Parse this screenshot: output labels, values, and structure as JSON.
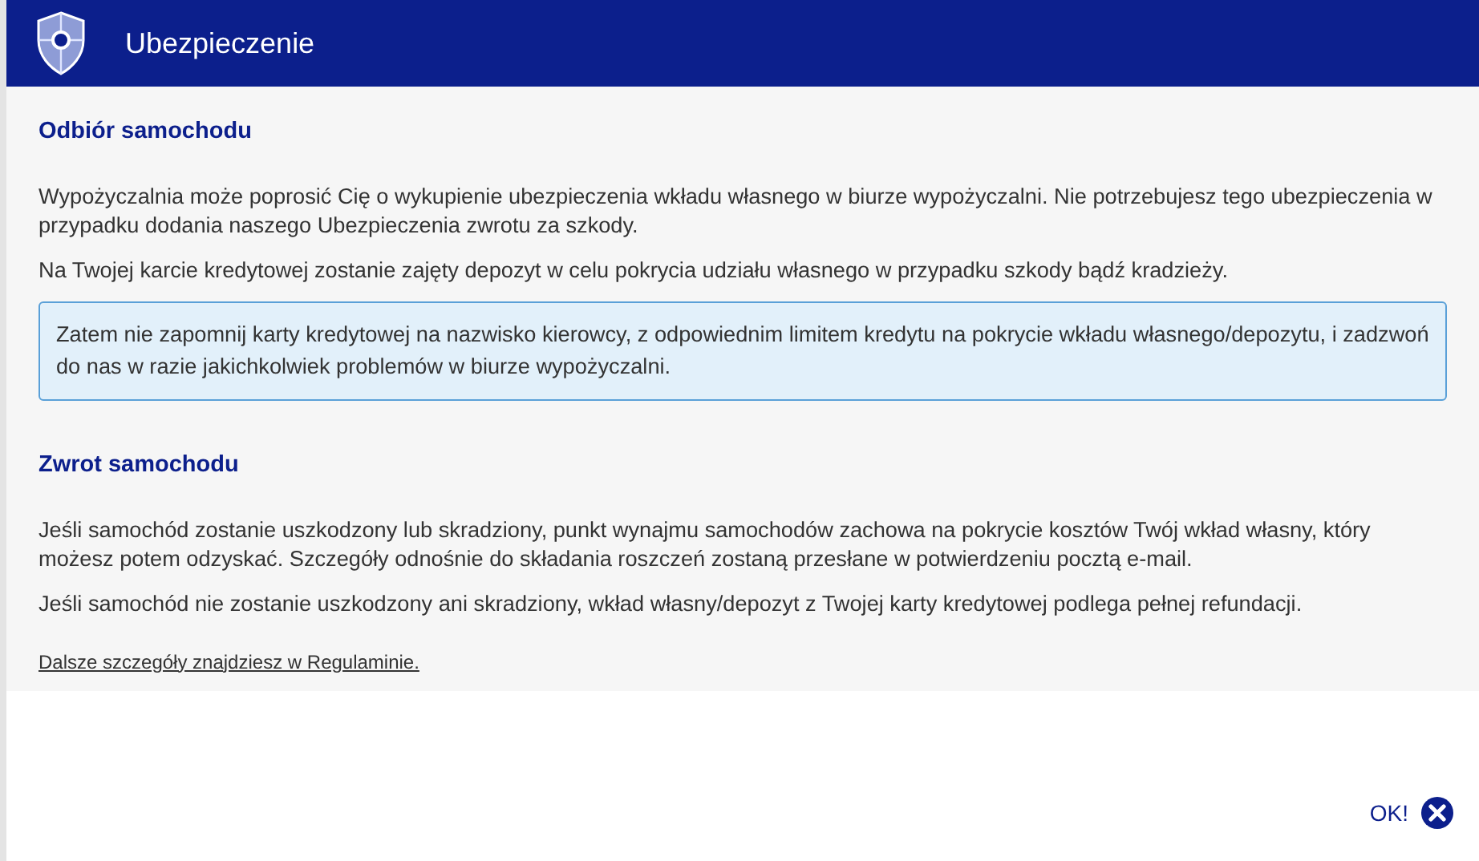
{
  "header": {
    "title": "Ubezpieczenie"
  },
  "sections": [
    {
      "heading": "Odbiór samochodu",
      "paragraphs": [
        "Wypożyczalnia może poprosić Cię o wykupienie ubezpieczenia wkładu własnego w biurze wypożyczalni. Nie potrzebujesz tego ubezpieczenia w przypadku dodania naszego Ubezpieczenia zwrotu za szkody.",
        "Na Twojej karcie kredytowej zostanie zajęty depozyt w celu pokrycia udziału własnego w przypadku szkody bądź kradzieży."
      ],
      "notice": "Zatem nie zapomnij karty kredytowej na nazwisko kierowcy, z odpowiednim limitem kredytu na pokrycie wkładu własnego/depozytu, i zadzwoń do nas w razie jakichkolwiek problemów w biurze wypożyczalni."
    },
    {
      "heading": "Zwrot samochodu",
      "paragraphs": [
        "Jeśli samochód zostanie uszkodzony lub skradziony, punkt wynajmu samochodów zachowa na pokrycie kosztów Twój wkład własny, który możesz potem odzyskać. Szczegóły odnośnie do składania roszczeń zostaną przesłane w potwierdzeniu pocztą e-mail.",
        "Jeśli samochód nie zostanie uszkodzony ani skradziony, wkład własny/depozyt z Twojej karty kredytowej podlega pełnej refundacji."
      ]
    }
  ],
  "terms_link": "Dalsze szczegóły znajdziesz w Regulaminie.",
  "ok_button": "OK!"
}
